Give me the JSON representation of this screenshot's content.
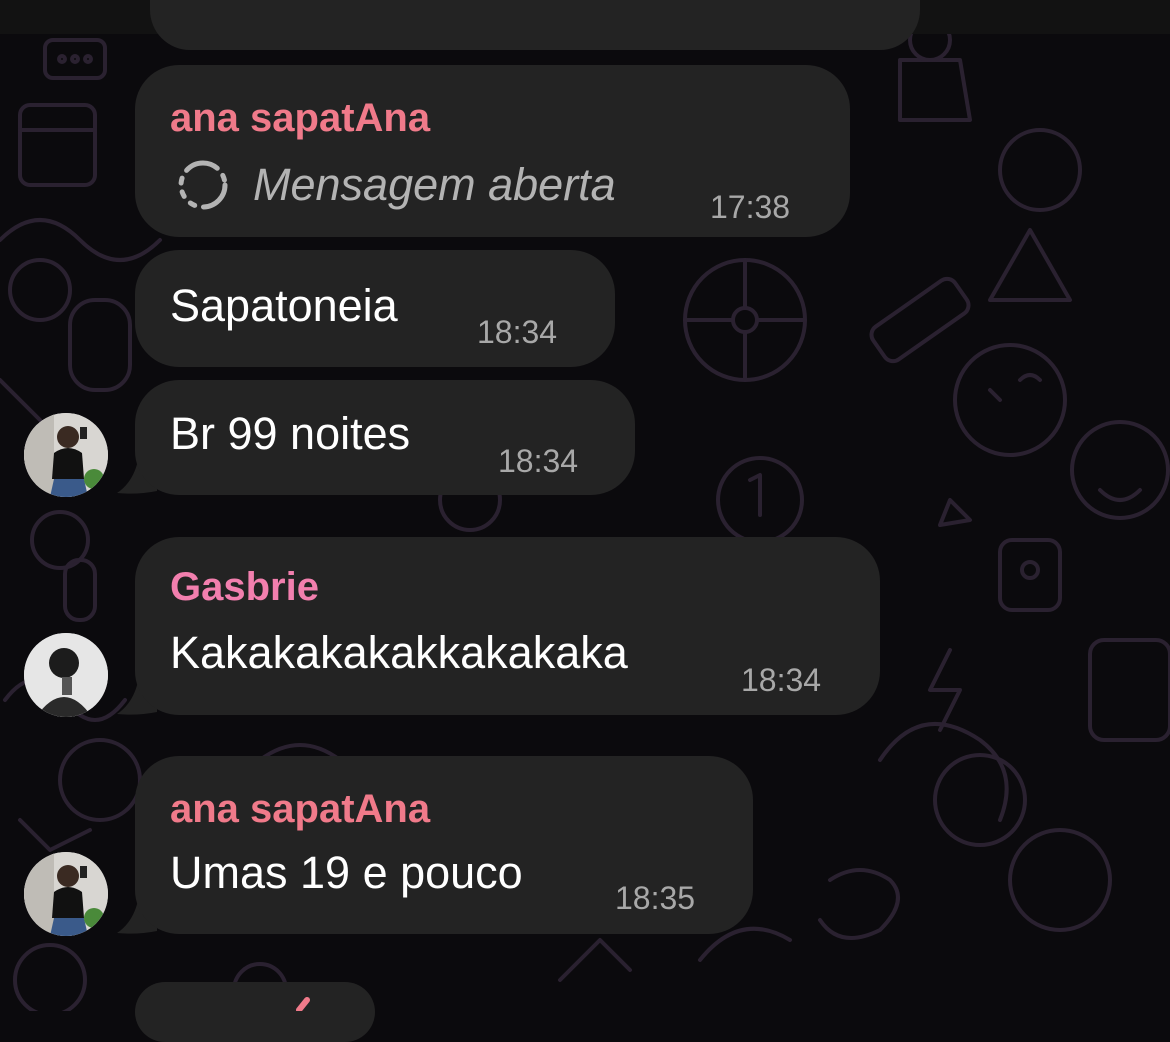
{
  "colors": {
    "background": "#0b0a0d",
    "bubble": "#232323",
    "sender_ana": "#f07a8a",
    "sender_gasbrie": "#f27fae",
    "timestamp": "#a8a8a8"
  },
  "messages": [
    {
      "sender": "ana sapatAna",
      "deleted_icon": "dashed-circle-icon",
      "text": "Mensagem aberta",
      "time": "17:38"
    },
    {
      "text": "Sapatoneia",
      "time": "18:34"
    },
    {
      "text": "Br 99 noites",
      "time": "18:34",
      "avatar": "avatar-ana"
    },
    {
      "sender": "Gasbrie",
      "text": "Kakakakakakkakakaka",
      "time": "18:34",
      "avatar": "avatar-gasbrie"
    },
    {
      "sender": "ana sapatAna",
      "text": "Umas 19 e pouco",
      "time": "18:35",
      "avatar": "avatar-ana"
    }
  ]
}
